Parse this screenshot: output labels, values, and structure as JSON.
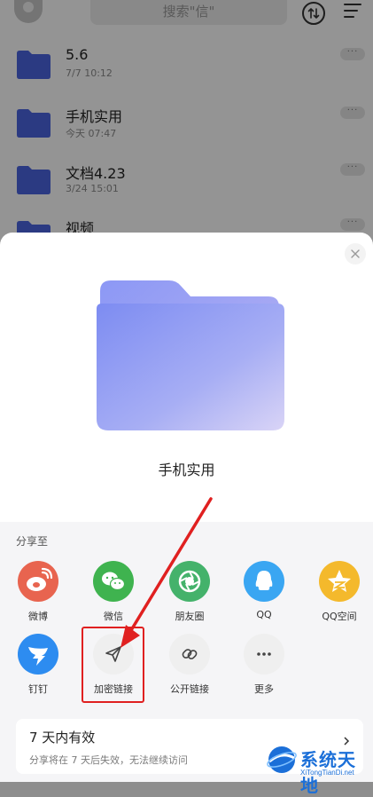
{
  "header": {
    "search_placeholder": "搜索\"信\""
  },
  "files": [
    {
      "name": "5.6",
      "date": "7/7 10:12"
    },
    {
      "name": "手机实用",
      "date": "今天 07:47"
    },
    {
      "name": "文档4.23",
      "date": "3/24 15:01"
    },
    {
      "name": "视频",
      "date": ""
    }
  ],
  "sheet": {
    "folder_name": "手机实用",
    "share_to_label": "分享至",
    "share_row1": [
      {
        "label": "微博",
        "icon": "weibo-icon",
        "color": "#e8644f"
      },
      {
        "label": "微信",
        "icon": "wechat-icon",
        "color": "#3fb34f"
      },
      {
        "label": "朋友圈",
        "icon": "moments-icon",
        "color": "#44b26b"
      },
      {
        "label": "QQ",
        "icon": "qq-icon",
        "color": "#3aa6f2"
      },
      {
        "label": "QQ空间",
        "icon": "qzone-icon",
        "color": "#f4b92c"
      }
    ],
    "share_row2": [
      {
        "label": "钉钉",
        "icon": "dingtalk-icon",
        "color": "#2d8cf0"
      },
      {
        "label": "加密链接",
        "icon": "send-icon",
        "color": "#efefef"
      },
      {
        "label": "公开链接",
        "icon": "link-icon",
        "color": "#efefef"
      },
      {
        "label": "更多",
        "icon": "more-icon",
        "color": "#efefef"
      }
    ],
    "validity_title": "7 天内有效",
    "validity_desc": "分享将在 7 天后失效，无法继续访问"
  },
  "watermark": {
    "title": "系统天地",
    "subtitle": "XiTongTianDi.net"
  },
  "colors": {
    "highlight": "#e02020",
    "folder": "#6f7fe8"
  }
}
